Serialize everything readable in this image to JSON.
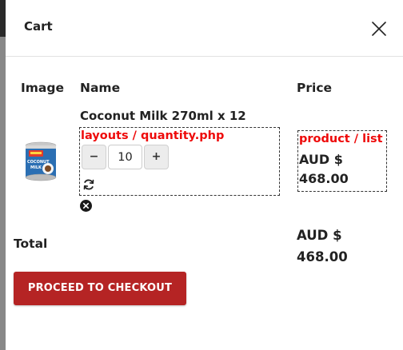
{
  "cart": {
    "title": "Cart",
    "close_icon": "close-icon"
  },
  "columns": {
    "image": "Image",
    "name": "Name",
    "price": "Price"
  },
  "item": {
    "name": "Coconut Milk 270ml x 12",
    "image_label": "AYAM COCONUT MILK",
    "debug_quantity_label": "layouts / quantity.php",
    "decrement_label": "−",
    "quantity": "10",
    "increment_label": "+",
    "refresh_icon": "refresh-icon",
    "remove_icon": "remove-icon",
    "debug_price_label": "product / list",
    "price": "AUD $ 468.00"
  },
  "total": {
    "label": "Total",
    "value": "AUD $ 468.00"
  },
  "checkout": {
    "label": "PROCEED TO CHECKOUT"
  },
  "colors": {
    "checkout_bg": "#b52424",
    "debug_text": "#ee0a0a",
    "text": "#222222"
  }
}
